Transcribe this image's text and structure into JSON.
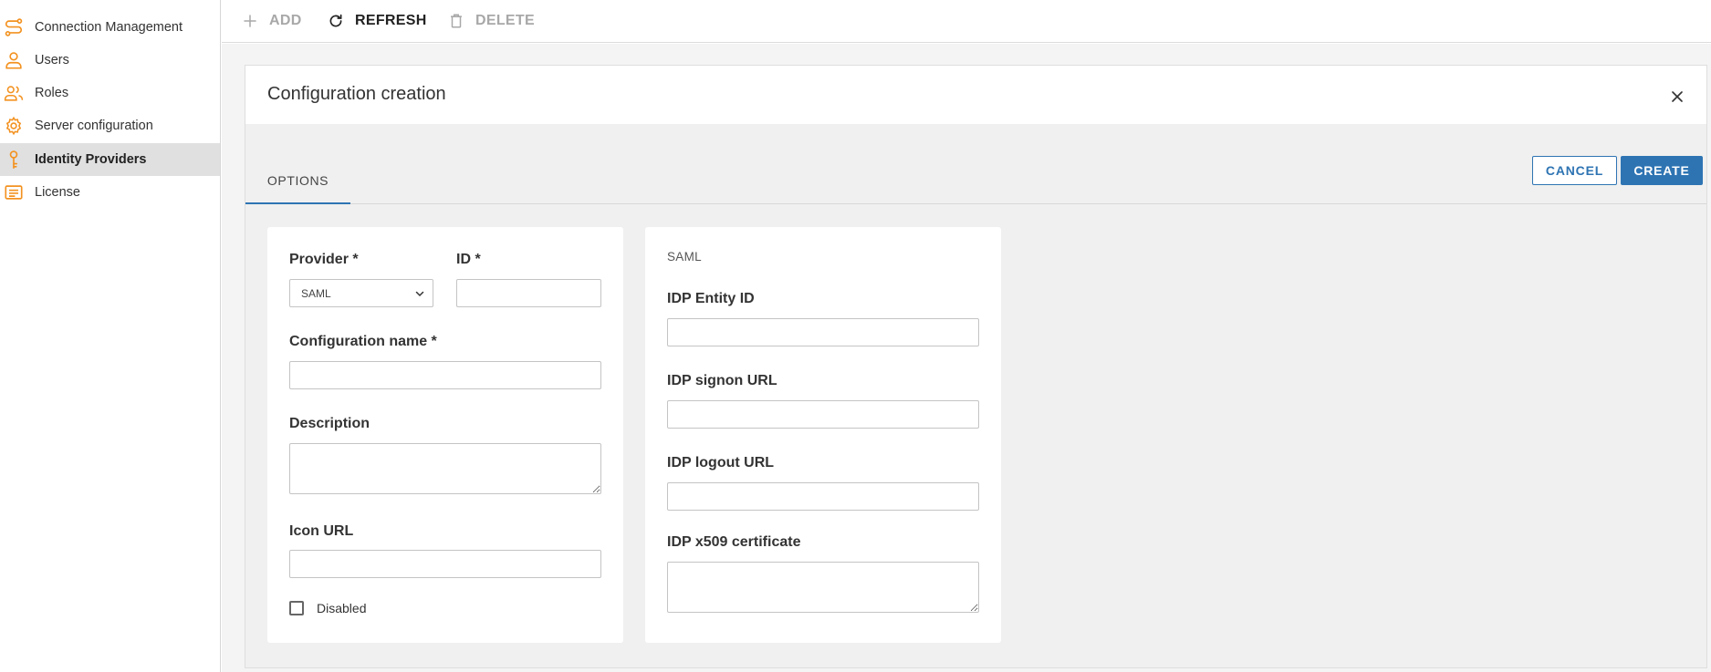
{
  "sidebar": {
    "items": [
      {
        "label": "Connection Management",
        "icon": "route-icon"
      },
      {
        "label": "Users",
        "icon": "user-icon"
      },
      {
        "label": "Roles",
        "icon": "users-icon"
      },
      {
        "label": "Server configuration",
        "icon": "gear-icon"
      },
      {
        "label": "Identity Providers",
        "icon": "key-icon",
        "active": true
      },
      {
        "label": "License",
        "icon": "license-icon"
      }
    ]
  },
  "toolbar": {
    "add_label": "ADD",
    "refresh_label": "REFRESH",
    "delete_label": "DELETE"
  },
  "dialog": {
    "title": "Configuration creation",
    "tab_options": "OPTIONS",
    "cancel_label": "CANCEL",
    "create_label": "CREATE",
    "general": {
      "provider_label": "Provider *",
      "provider_value": "SAML",
      "id_label": "ID *",
      "id_value": "",
      "config_name_label": "Configuration name *",
      "config_name_value": "",
      "description_label": "Description",
      "description_value": "",
      "icon_url_label": "Icon URL",
      "icon_url_value": "",
      "disabled_label": "Disabled",
      "disabled_checked": false
    },
    "saml": {
      "section_title": "SAML",
      "entity_id_label": "IDP Entity ID",
      "entity_id_value": "",
      "signon_url_label": "IDP signon URL",
      "signon_url_value": "",
      "logout_url_label": "IDP logout URL",
      "logout_url_value": "",
      "cert_label": "IDP x509 certificate",
      "cert_value": ""
    }
  },
  "colors": {
    "accent": "#2e74b3",
    "icon_orange": "#f39220",
    "active_bg": "#e0e0e0"
  }
}
